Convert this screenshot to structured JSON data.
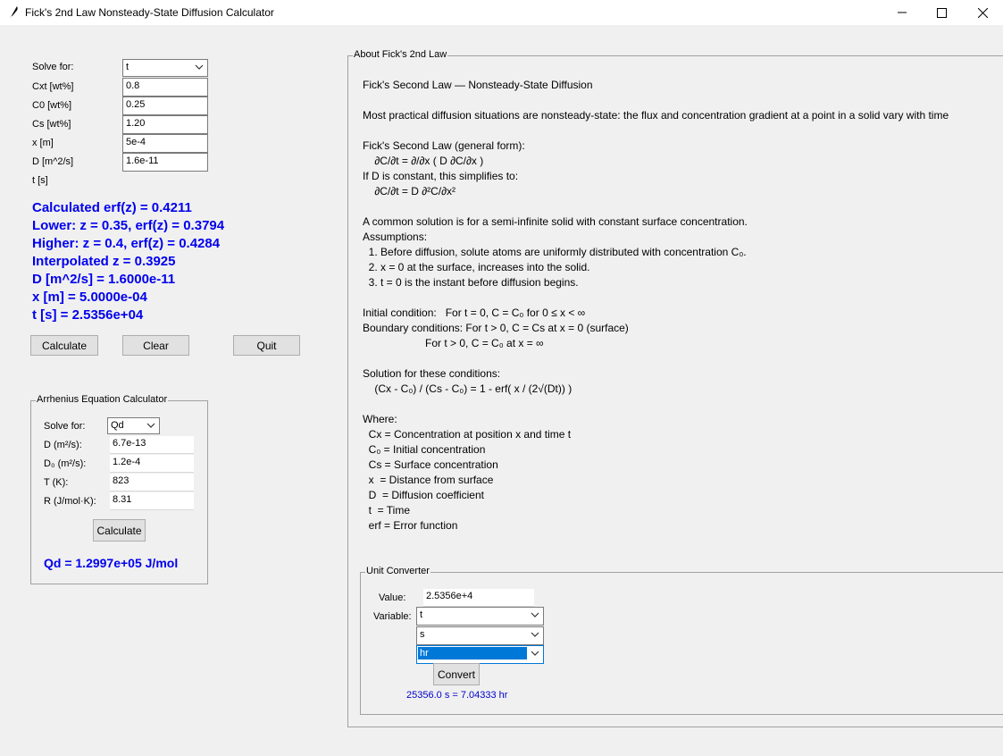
{
  "window": {
    "title": "Fick's 2nd Law Nonsteady-State Diffusion Calculator"
  },
  "fick": {
    "solve_for_label": "Solve for:",
    "solve_for_value": "t",
    "fields": [
      {
        "label": "Cxt [wt%]",
        "value": "0.8"
      },
      {
        "label": "C0 [wt%]",
        "value": "0.25"
      },
      {
        "label": "Cs [wt%]",
        "value": "1.20"
      },
      {
        "label": "x [m]",
        "value": "5e-4"
      },
      {
        "label": "D [m^2/s]",
        "value": "1.6e-11"
      },
      {
        "label": "t [s]",
        "value": ""
      }
    ],
    "results": [
      "Calculated erf(z) = 0.4211",
      "Lower: z = 0.35, erf(z) = 0.3794",
      "Higher: z = 0.4, erf(z) = 0.4284",
      "Interpolated z = 0.3925",
      "D [m^2/s] = 1.6000e-11",
      "x [m] = 5.0000e-04",
      "t [s] = 2.5356e+04"
    ],
    "buttons": {
      "calculate": "Calculate",
      "clear": "Clear",
      "quit": "Quit"
    }
  },
  "arrhenius": {
    "title": "Arrhenius Equation Calculator",
    "solve_for_label": "Solve for:",
    "solve_for_value": "Qd",
    "fields": [
      {
        "label": "D (m²/s):",
        "value": "6.7e-13"
      },
      {
        "label": "D₀ (m²/s):",
        "value": "1.2e-4"
      },
      {
        "label": "T (K):",
        "value": "823"
      },
      {
        "label": "R (J/mol·K):",
        "value": "8.31"
      }
    ],
    "calculate": "Calculate",
    "result": "Qd = 1.2997e+05 J/mol"
  },
  "about": {
    "title": "About Fick's 2nd Law",
    "lines": [
      "Fick's Second Law — Nonsteady-State Diffusion",
      "Most practical diffusion situations are nonsteady-state: the flux and concentration gradient at a point in a solid vary with time",
      "Fick's Second Law (general form):",
      "    ∂C/∂t = ∂/∂x ( D ∂C/∂x )",
      "If D is constant, this simplifies to:",
      "    ∂C/∂t = D ∂²C/∂x²",
      "A common solution is for a semi-infinite solid with constant surface concentration.",
      "Assumptions:",
      "  1. Before diffusion, solute atoms are uniformly distributed with concentration C₀.",
      "  2. x = 0 at the surface, increases into the solid.",
      "  3. t = 0 is the instant before diffusion begins.",
      "Initial condition:   For t = 0, C = C₀ for 0 ≤ x < ∞",
      "Boundary conditions: For t > 0, C = Cs at x = 0 (surface)",
      "                     For t > 0, C = C₀ at x = ∞",
      "Solution for these conditions:",
      "    (Cx - C₀) / (Cs - C₀) = 1 - erf( x / (2√(Dt)) )",
      "Where:",
      "  Cx = Concentration at position x and time t",
      "  C₀ = Initial concentration",
      "  Cs = Surface concentration",
      "  x  = Distance from surface",
      "  D  = Diffusion coefficient",
      "  t  = Time",
      "  erf = Error function"
    ]
  },
  "converter": {
    "title": "Unit Converter",
    "value_label": "Value:",
    "value": "2.5356e+4",
    "variable_label": "Variable:",
    "variable": "t",
    "from_unit": "s",
    "to_unit": "hr",
    "convert": "Convert",
    "result": "25356.0 s = 7.04333 hr"
  },
  "colors": {
    "result_blue": "#0000ee",
    "select_blue": "#0078d7"
  }
}
